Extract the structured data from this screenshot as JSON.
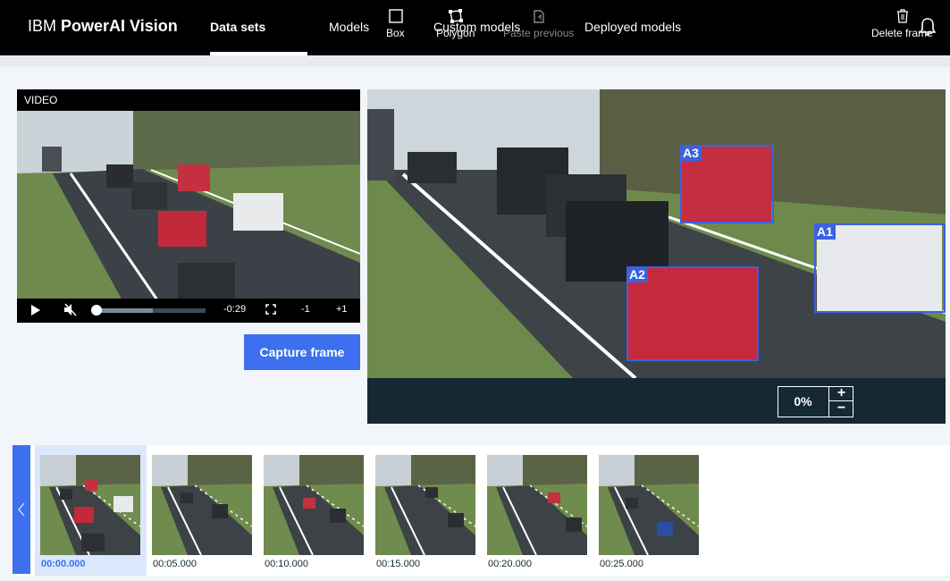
{
  "header": {
    "brand_prefix": "IBM",
    "brand_name": "PowerAI Vision",
    "nav": [
      {
        "label": "Data sets",
        "active": true
      },
      {
        "label": "Models",
        "active": false
      },
      {
        "label": "Custom models",
        "active": false
      },
      {
        "label": "Deployed models",
        "active": false
      }
    ],
    "bell_icon": "bell-icon"
  },
  "video": {
    "label": "VIDEO",
    "time_remaining": "-0:29",
    "step_back": "-1",
    "step_forward": "+1",
    "progress": 0.52,
    "icons": [
      "play-icon",
      "mute-icon",
      "fullscreen-icon"
    ]
  },
  "capture_button": "Capture frame",
  "annotations": [
    {
      "label": "A3"
    },
    {
      "label": "A1"
    },
    {
      "label": "A2"
    }
  ],
  "toolbar": {
    "box": "Box",
    "polygon": "Polygon",
    "paste_previous": "Paste previous",
    "zoom": "0%",
    "zoom_in": "+",
    "zoom_out": "−",
    "delete_frame": "Delete frame"
  },
  "frames": [
    {
      "time": "00:00.000",
      "selected": true
    },
    {
      "time": "00:05.000",
      "selected": false
    },
    {
      "time": "00:10.000",
      "selected": false
    },
    {
      "time": "00:15.000",
      "selected": false
    },
    {
      "time": "00:20.000",
      "selected": false
    },
    {
      "time": "00:25.000",
      "selected": false
    }
  ],
  "colors": {
    "accent": "#3d70ee",
    "bbox": "#3b62e0",
    "header_bg": "#000000",
    "toolbar_bg": "#152935"
  }
}
